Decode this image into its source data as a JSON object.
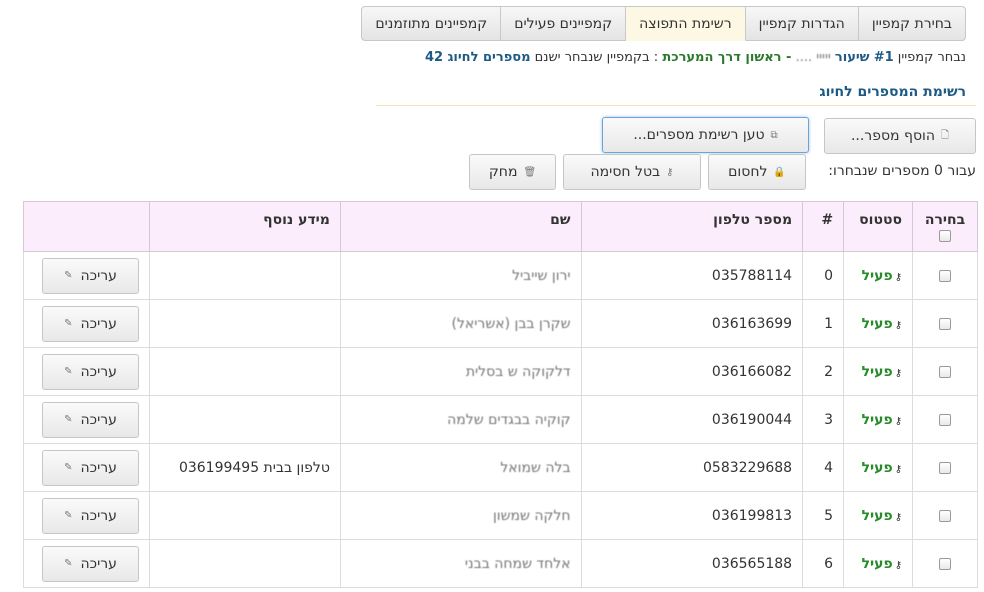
{
  "tabs": [
    {
      "label": "בחירת קמפיין",
      "active": false
    },
    {
      "label": "הגדרות קמפיין",
      "active": false
    },
    {
      "label": "רשימת התפוצה",
      "active": true
    },
    {
      "label": "קמפיינים פעילים",
      "active": false
    },
    {
      "label": "קמפיינים מתוזמנים",
      "active": false
    }
  ],
  "campaign_info": {
    "prefix": "נבחר קמפיין",
    "number": "#1",
    "name": "שיעור",
    "channel": "- ראשון דרך המערכת",
    "middle": ": בקמפיין שנבחר ישנם",
    "count_label": "מספרים לחיוג 42"
  },
  "section": {
    "title": "רשימת המספרים לחיוג"
  },
  "buttons": {
    "add_number": "הוסף מספר...",
    "load_list": "טען רשימת מספרים...",
    "selected_label": "עבור 0 מספרים שנבחרו:",
    "block": "לחסום",
    "unblock": "בטל חסימה",
    "delete": "מחק"
  },
  "table": {
    "headers": {
      "select": "בחירה",
      "status": "סטטוס",
      "num": "#",
      "phone": "מספר טלפון",
      "name": "שם",
      "info": "מידע נוסף"
    },
    "edit_label": "עריכה",
    "rows": [
      {
        "status": "פעיל",
        "num": "0",
        "phone": "035788114",
        "name": "ירון שייביל",
        "info": ""
      },
      {
        "status": "פעיל",
        "num": "1",
        "phone": "036163699",
        "name": "שקרן בבן (אשריאל)",
        "info": ""
      },
      {
        "status": "פעיל",
        "num": "2",
        "phone": "036166082",
        "name": "דלקוקה ש בסלית",
        "info": ""
      },
      {
        "status": "פעיל",
        "num": "3",
        "phone": "036190044",
        "name": "קוקיה בבגדים שלמה",
        "info": ""
      },
      {
        "status": "פעיל",
        "num": "4",
        "phone": "0583229688",
        "name": "בלה שמואל",
        "info": "טלפון בבית 036199495"
      },
      {
        "status": "פעיל",
        "num": "5",
        "phone": "036199813",
        "name": "חלקה שמשון",
        "info": ""
      },
      {
        "status": "פעיל",
        "num": "6",
        "phone": "036565188",
        "name": "אלחד שמחה בבני",
        "info": ""
      }
    ]
  }
}
